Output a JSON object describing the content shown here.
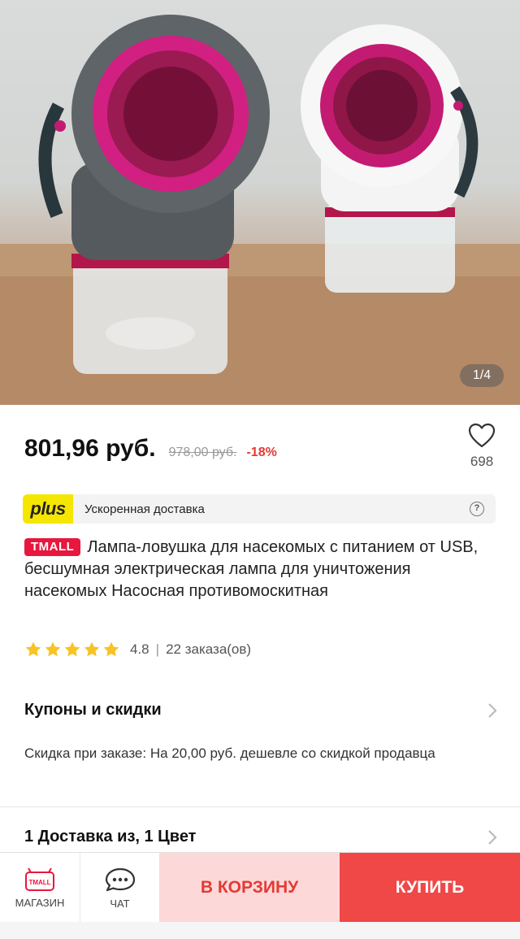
{
  "gallery": {
    "counter": "1/4"
  },
  "price": {
    "current": "801,96 руб.",
    "old": "978,00 руб.",
    "discount": "-18%"
  },
  "wishlist": {
    "count": "698"
  },
  "plus": {
    "logo": "plus",
    "text": "Ускоренная доставка"
  },
  "product": {
    "badge": "TMALL",
    "title": "Лампа-ловушка для насекомых с питанием от USB, бесшумная электрическая лампа для уничтожения насекомых Насосная противомоскитная"
  },
  "rating": {
    "stars": 5,
    "value": "4.8",
    "separator": "|",
    "orders": "22 заказа(ов)"
  },
  "coupons": {
    "title": "Купоны и скидки",
    "text": "Скидка при заказе: На 20,00 руб. дешевле со скидкой продавца"
  },
  "delivery": {
    "title": "1 Доставка из, 1 Цвет"
  },
  "bottom_bar": {
    "store_label": "МАГАЗИН",
    "store_icon_text": "TMALL",
    "chat_label": "ЧАТ",
    "cart_label": "В КОРЗИНУ",
    "buy_label": "КУПИТЬ"
  },
  "colors": {
    "accent": "#e53935",
    "buy": "#f04747",
    "cart_bg": "#fcd9d8",
    "tmall": "#e8173d",
    "plus": "#f5e600",
    "star": "#f7c325"
  }
}
